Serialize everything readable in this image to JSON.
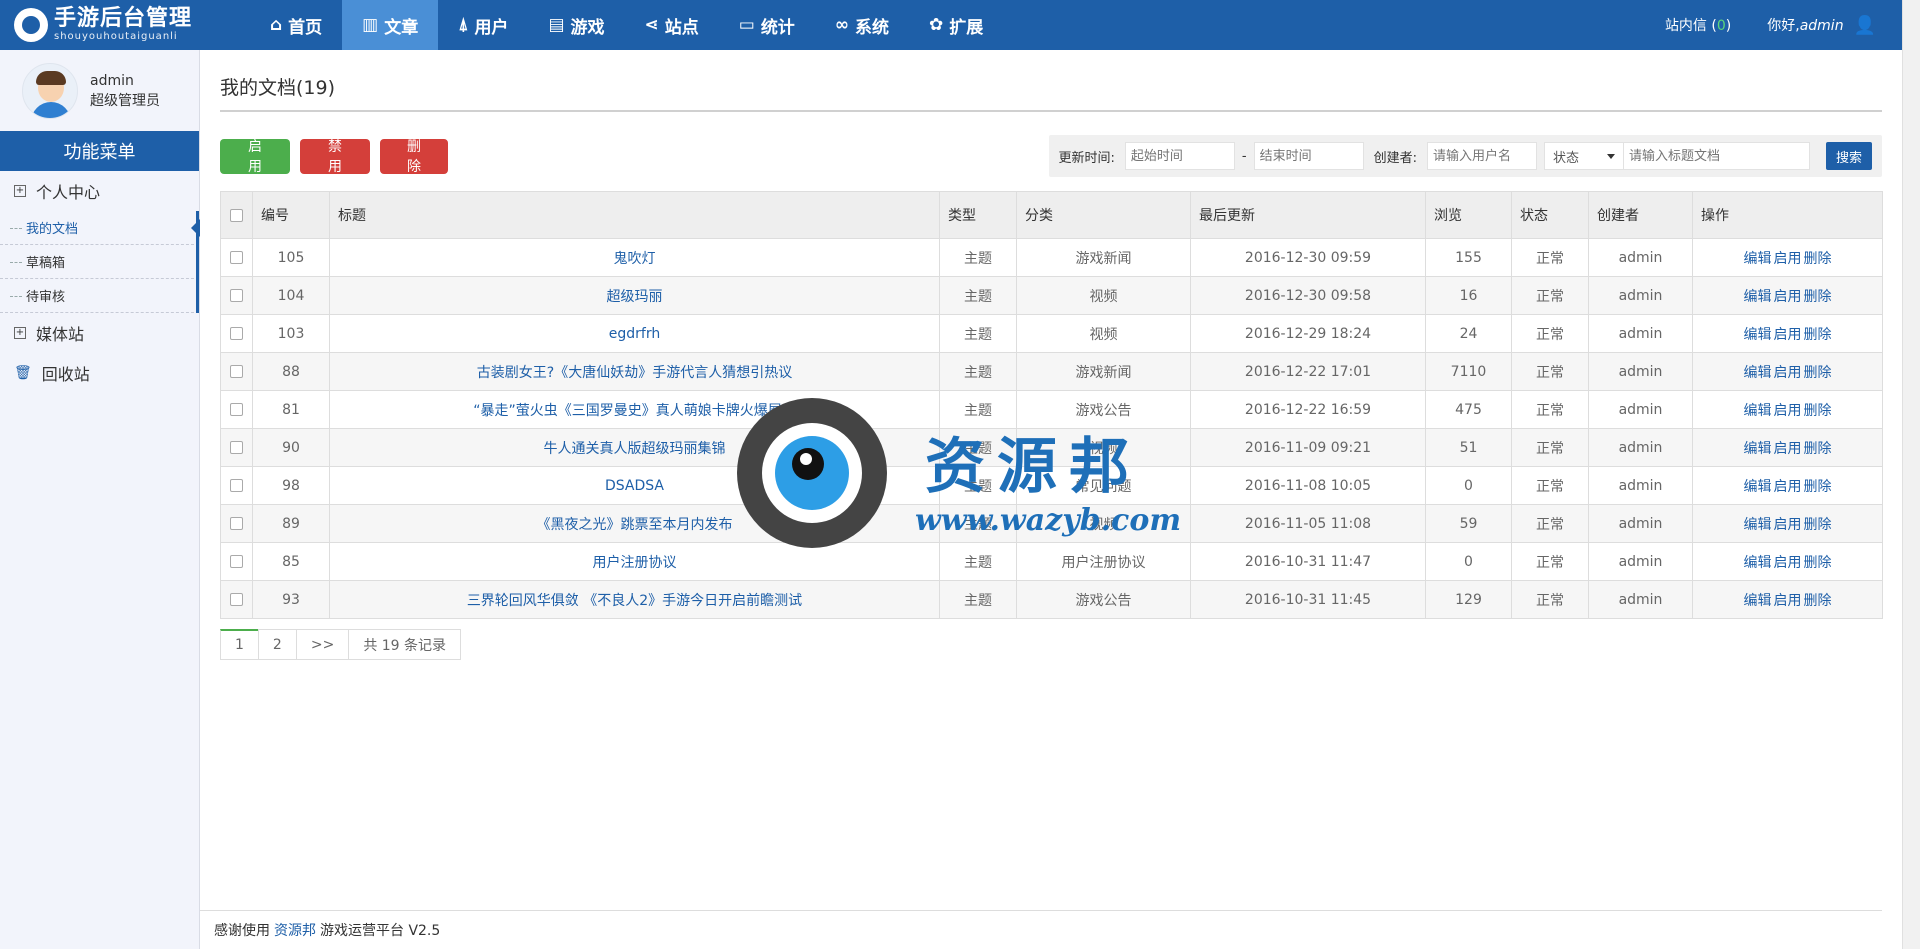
{
  "brand": {
    "title": "手游后台管理",
    "subtitle": "shouyouhoutaiguanli"
  },
  "nav": [
    {
      "label": "首页",
      "icon": "home-icon",
      "glyph": "⌂"
    },
    {
      "label": "文章",
      "icon": "bar-chart-icon",
      "glyph": "▥"
    },
    {
      "label": "用户",
      "icon": "user-icon",
      "glyph": "⍋"
    },
    {
      "label": "游戏",
      "icon": "book-icon",
      "glyph": "▤"
    },
    {
      "label": "站点",
      "icon": "share-icon",
      "glyph": "⋖"
    },
    {
      "label": "统计",
      "icon": "monitor-icon",
      "glyph": "▭"
    },
    {
      "label": "系统",
      "icon": "link-icon",
      "glyph": "∞"
    },
    {
      "label": "扩展",
      "icon": "gear-icon",
      "glyph": "✿"
    }
  ],
  "topright": {
    "msg_label": "站内信",
    "msg_count": "0",
    "hello": "你好,",
    "username": "admin"
  },
  "profile": {
    "name": "admin",
    "role": "超级管理员"
  },
  "sidebar": {
    "header": "功能菜单",
    "group_personal": "个人中心",
    "items": [
      "我的文档",
      "草稿箱",
      "待审核"
    ],
    "group_media": "媒体站",
    "group_trash": "回收站"
  },
  "page": {
    "title": "我的文档(19)"
  },
  "toolbar": {
    "enable": "启 用",
    "disable": "禁 用",
    "delete": "删 除"
  },
  "search": {
    "time_label": "更新时间:",
    "start_placeholder": "起始时间",
    "dash": "-",
    "end_placeholder": "结束时间",
    "creator_label": "创建者:",
    "creator_placeholder": "请输入用户名",
    "status_label": "状态",
    "title_placeholder": "请输入标题文档",
    "button": "搜索"
  },
  "table": {
    "headers": [
      "编号",
      "标题",
      "类型",
      "分类",
      "最后更新",
      "浏览",
      "状态",
      "创建者",
      "操作"
    ],
    "ops": [
      "编辑",
      "启用",
      "删除"
    ],
    "rows": [
      {
        "id": "105",
        "title": "鬼吹灯",
        "type": "主题",
        "cat": "游戏新闻",
        "updated": "2016-12-30 09:59",
        "views": "155",
        "status": "正常",
        "creator": "admin"
      },
      {
        "id": "104",
        "title": "超级玛丽",
        "type": "主题",
        "cat": "视频",
        "updated": "2016-12-30 09:58",
        "views": "16",
        "status": "正常",
        "creator": "admin"
      },
      {
        "id": "103",
        "title": "egdrfrh",
        "type": "主题",
        "cat": "视频",
        "updated": "2016-12-29 18:24",
        "views": "24",
        "status": "正常",
        "creator": "admin"
      },
      {
        "id": "88",
        "title": "古装剧女王?《大唐仙妖劫》手游代言人猜想引热议",
        "type": "主题",
        "cat": "游戏新闻",
        "updated": "2016-12-22 17:01",
        "views": "7110",
        "status": "正常",
        "creator": "admin"
      },
      {
        "id": "81",
        "title": "“暴走”萤火虫《三国罗曼史》真人萌娘卡牌火爆展现",
        "type": "主题",
        "cat": "游戏公告",
        "updated": "2016-12-22 16:59",
        "views": "475",
        "status": "正常",
        "creator": "admin"
      },
      {
        "id": "90",
        "title": "牛人通关真人版超级玛丽集锦",
        "type": "主题",
        "cat": "视频",
        "updated": "2016-11-09 09:21",
        "views": "51",
        "status": "正常",
        "creator": "admin"
      },
      {
        "id": "98",
        "title": "DSADSA",
        "type": "主题",
        "cat": "常见问题",
        "updated": "2016-11-08 10:05",
        "views": "0",
        "status": "正常",
        "creator": "admin"
      },
      {
        "id": "89",
        "title": "《黑夜之光》跳票至本月内发布",
        "type": "主题",
        "cat": "视频",
        "updated": "2016-11-05 11:08",
        "views": "59",
        "status": "正常",
        "creator": "admin"
      },
      {
        "id": "85",
        "title": "用户注册协议",
        "type": "主题",
        "cat": "用户注册协议",
        "updated": "2016-10-31 11:47",
        "views": "0",
        "status": "正常",
        "creator": "admin"
      },
      {
        "id": "93",
        "title": "三界轮回风华俱敛 《不良人2》手游今日开启前瞻测试",
        "type": "主题",
        "cat": "游戏公告",
        "updated": "2016-10-31 11:45",
        "views": "129",
        "status": "正常",
        "creator": "admin"
      }
    ]
  },
  "pager": {
    "pages": [
      "1",
      "2"
    ],
    "next": ">>",
    "total": "共 19 条记录"
  },
  "footer": {
    "prefix": "感谢使用",
    "link": "资源邦",
    "suffix": "游戏运营平台 V2.5"
  },
  "watermark": {
    "cn": "资源邦",
    "en": "www.wazyb.com"
  }
}
